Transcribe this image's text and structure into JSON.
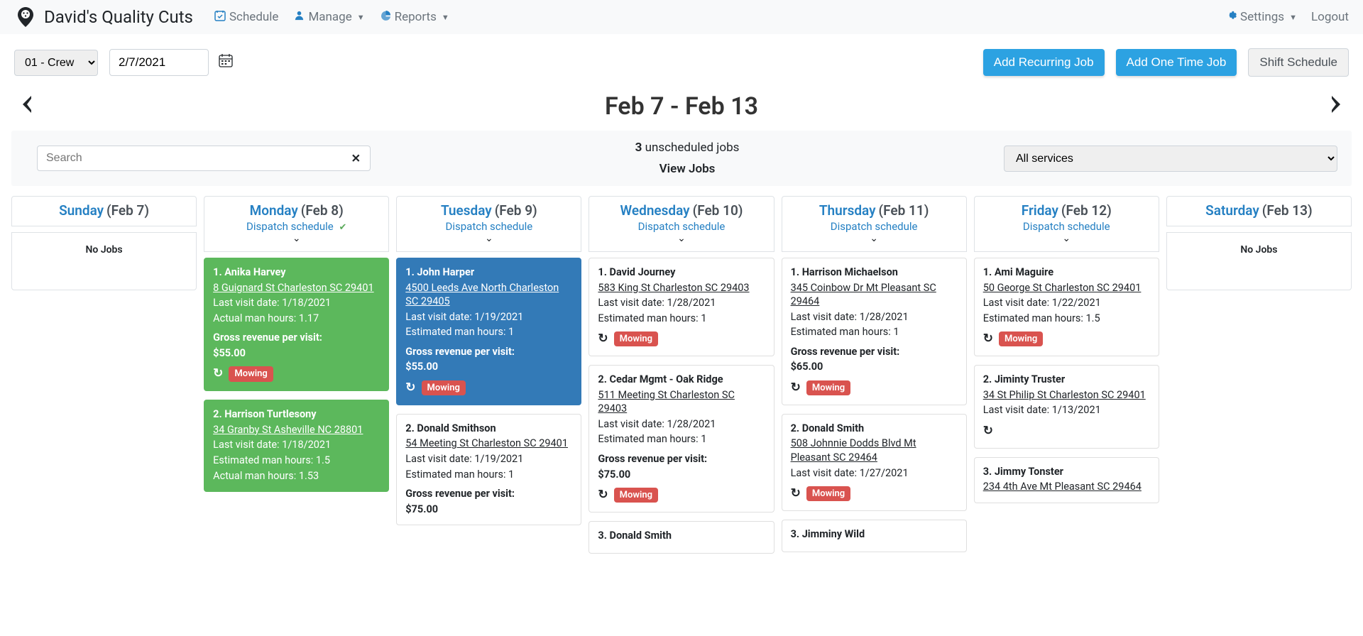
{
  "brand": {
    "name": "David's Quality Cuts"
  },
  "nav": {
    "schedule": "Schedule",
    "manage": "Manage",
    "reports": "Reports",
    "settings": "Settings",
    "logout": "Logout"
  },
  "toolbar": {
    "crew_select": "01 - Crew",
    "date_input": "2/7/2021",
    "add_recurring": "Add Recurring Job",
    "add_onetime": "Add One Time Job",
    "shift_schedule": "Shift Schedule"
  },
  "week": {
    "title": "Feb 7 - Feb 13"
  },
  "search": {
    "placeholder": "Search",
    "unscheduled_count": "3",
    "unscheduled_text": "unscheduled jobs",
    "view_jobs": "View Jobs",
    "service_filter": "All services"
  },
  "dispatch_label": "Dispatch schedule",
  "no_jobs_label": "No Jobs",
  "days": [
    {
      "name": "Sunday",
      "date": "(Feb 7)",
      "has_dispatch": false,
      "no_jobs": true,
      "jobs": []
    },
    {
      "name": "Monday",
      "date": "(Feb 8)",
      "has_dispatch": true,
      "dispatched": true,
      "no_jobs": false,
      "jobs": [
        {
          "style": "green",
          "title": "1. Anika Harvey",
          "address": "8 Guignard St Charleston SC 29401",
          "lines": [
            "Last visit date: 1/18/2021",
            "Actual man hours: 1.17"
          ],
          "strong_lines": [
            "Gross revenue per visit: ",
            "$55.00"
          ],
          "show_tag": true,
          "tag": "Mowing"
        },
        {
          "style": "green",
          "title": "2. Harrison Turtlesony",
          "address": "34 Granby St Asheville NC 28801",
          "lines": [
            "Last visit date: 1/18/2021",
            "Estimated man hours: 1.5",
            "Actual man hours: 1.53"
          ],
          "strong_lines": [],
          "show_tag": false
        }
      ]
    },
    {
      "name": "Tuesday",
      "date": "(Feb 9)",
      "has_dispatch": true,
      "dispatched": false,
      "no_jobs": false,
      "jobs": [
        {
          "style": "blue",
          "title": "1. John Harper",
          "address": "4500 Leeds Ave North Charleston SC 29405",
          "lines": [
            "Last visit date: 1/19/2021",
            "Estimated man hours: 1"
          ],
          "strong_lines": [
            "Gross revenue per visit: ",
            "$55.00"
          ],
          "show_tag": true,
          "tag": "Mowing"
        },
        {
          "style": "white",
          "title": "2. Donald Smithson",
          "address": "54 Meeting St Charleston SC 29401",
          "lines": [
            "Last visit date: 1/19/2021",
            "Estimated man hours: 1"
          ],
          "strong_lines": [
            "Gross revenue per visit: ",
            "$75.00"
          ],
          "show_tag": false
        }
      ]
    },
    {
      "name": "Wednesday",
      "date": "(Feb 10)",
      "has_dispatch": true,
      "dispatched": false,
      "no_jobs": false,
      "jobs": [
        {
          "style": "white",
          "title": "1. David Journey",
          "address": "583 King St Charleston SC 29403",
          "lines": [
            "Last visit date: 1/28/2021",
            "Estimated man hours: 1"
          ],
          "strong_lines": [],
          "show_tag": true,
          "tag": "Mowing"
        },
        {
          "style": "white",
          "title": "2. Cedar Mgmt - Oak Ridge",
          "address": "511 Meeting St Charleston SC 29403",
          "lines": [
            "Last visit date: 1/28/2021",
            "Estimated man hours: 1"
          ],
          "strong_lines": [
            "Gross revenue per visit: ",
            "$75.00"
          ],
          "show_tag": true,
          "tag": "Mowing"
        },
        {
          "style": "white",
          "title": "3. Donald Smith",
          "address": "",
          "lines": [],
          "strong_lines": [],
          "show_tag": false
        }
      ]
    },
    {
      "name": "Thursday",
      "date": "(Feb 11)",
      "has_dispatch": true,
      "dispatched": false,
      "no_jobs": false,
      "jobs": [
        {
          "style": "white",
          "title": "1. Harrison Michaelson",
          "address": "345 Coinbow Dr Mt Pleasant SC 29464",
          "lines": [
            "Last visit date: 1/28/2021",
            "Estimated man hours: 1"
          ],
          "strong_lines": [
            "Gross revenue per visit: ",
            "$65.00"
          ],
          "show_tag": true,
          "tag": "Mowing"
        },
        {
          "style": "white",
          "title": "2. Donald Smith",
          "address": "508 Johnnie Dodds Blvd Mt Pleasant SC 29464",
          "lines": [
            "Last visit date: 1/27/2021"
          ],
          "strong_lines": [],
          "show_tag": true,
          "tag": "Mowing"
        },
        {
          "style": "white",
          "title": "3. Jimminy Wild",
          "address": "",
          "lines": [],
          "strong_lines": [],
          "show_tag": false
        }
      ]
    },
    {
      "name": "Friday",
      "date": "(Feb 12)",
      "has_dispatch": true,
      "dispatched": false,
      "no_jobs": false,
      "jobs": [
        {
          "style": "white",
          "title": "1. Ami Maguire",
          "address": "50 George St Charleston SC 29401",
          "lines": [
            "Last visit date: 1/22/2021",
            "Estimated man hours: 1.5"
          ],
          "strong_lines": [],
          "show_tag": true,
          "tag": "Mowing"
        },
        {
          "style": "white",
          "title": "2. Jiminty Truster",
          "address": "34 St Philip St Charleston SC 29401",
          "lines": [
            "Last visit date: 1/13/2021"
          ],
          "strong_lines": [],
          "show_tag": true,
          "tag": "",
          "hide_tag_label": true
        },
        {
          "style": "white",
          "title": "3. Jimmy Tonster",
          "address": "234 4th Ave Mt Pleasant SC 29464",
          "lines": [],
          "strong_lines": [],
          "show_tag": false
        }
      ]
    },
    {
      "name": "Saturday",
      "date": "(Feb 13)",
      "has_dispatch": false,
      "no_jobs": true,
      "jobs": []
    }
  ]
}
